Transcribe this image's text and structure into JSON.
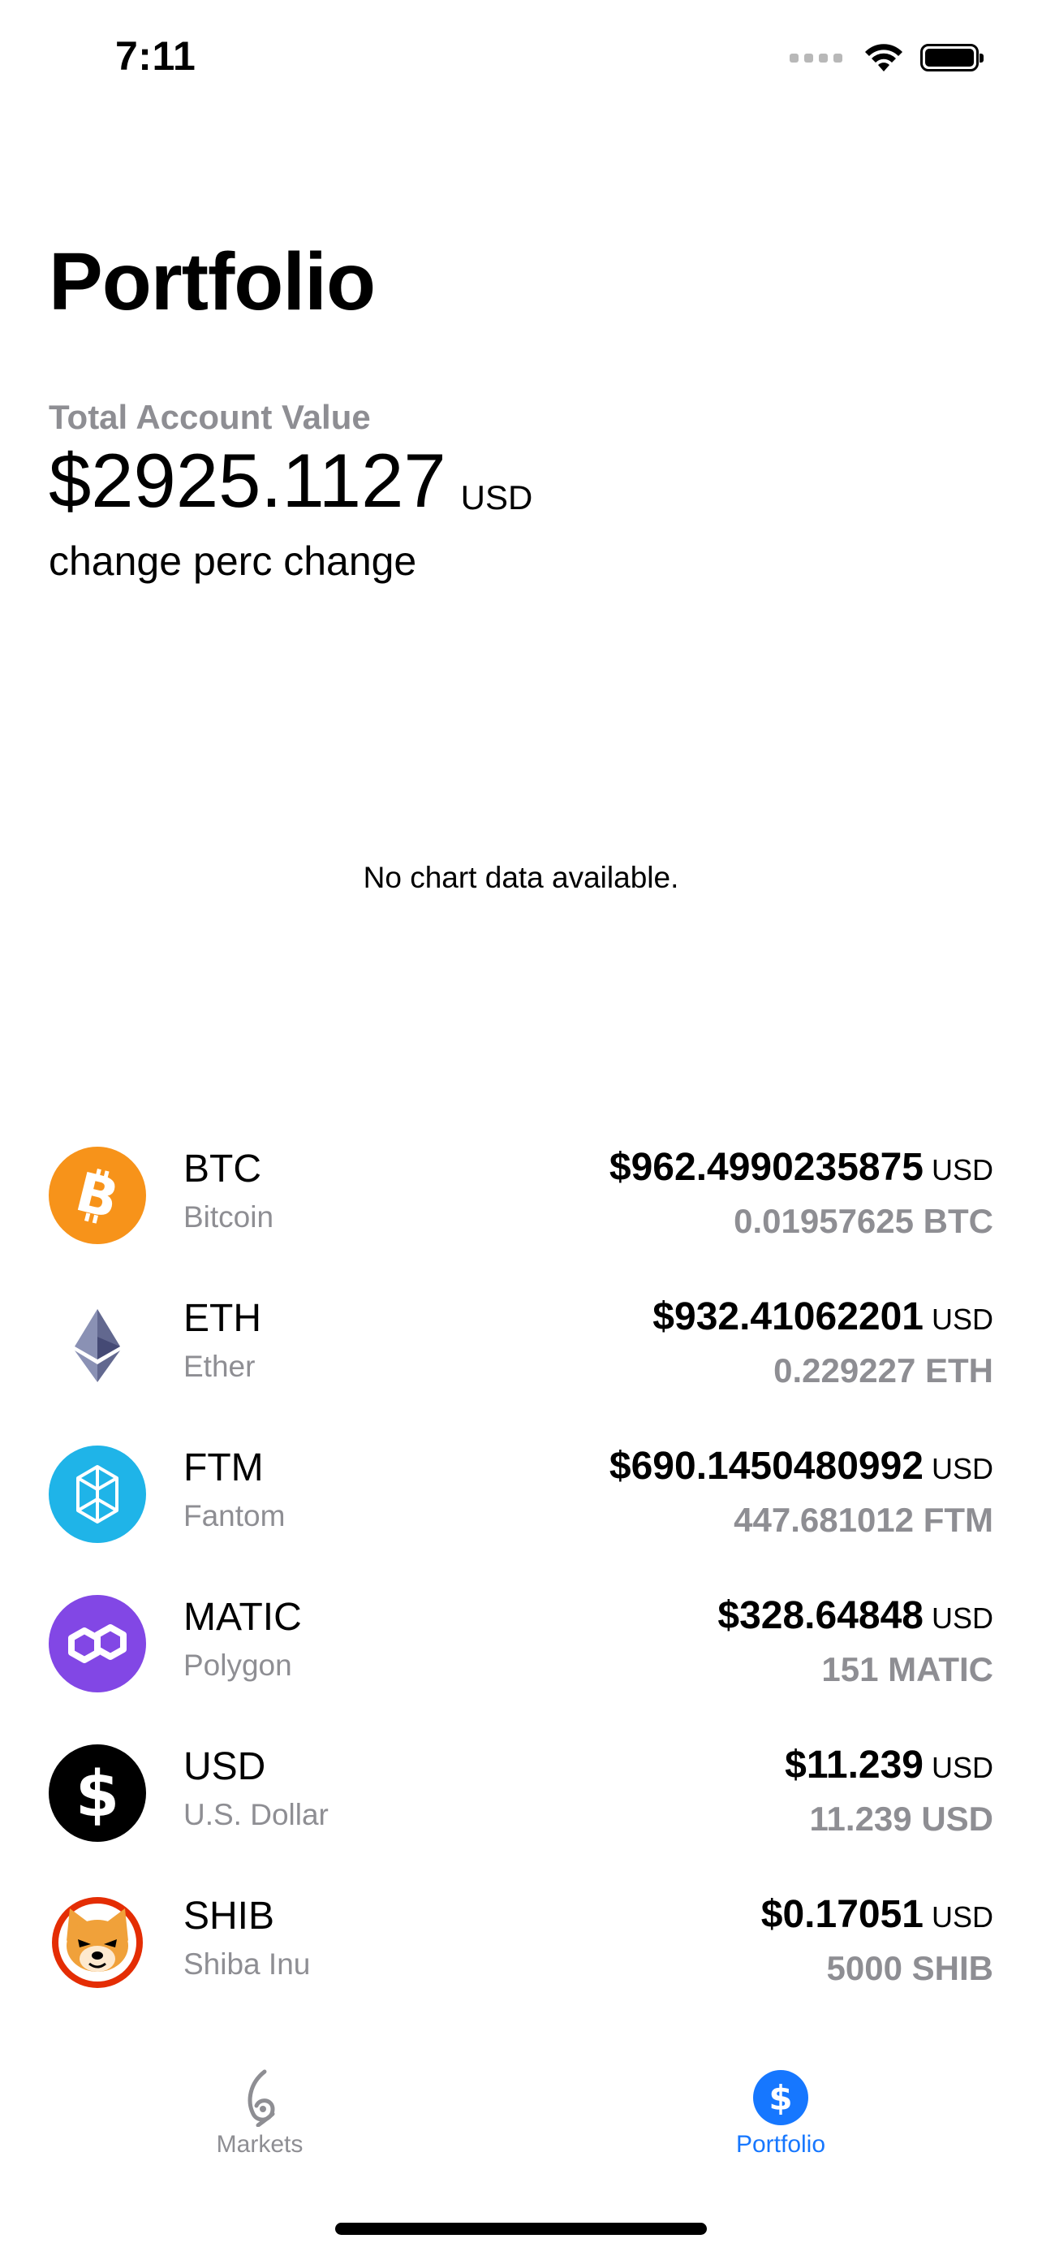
{
  "status_bar": {
    "time": "7:11",
    "icons": [
      "signal-icon",
      "wifi-icon",
      "battery-icon"
    ]
  },
  "page": {
    "title": "Portfolio",
    "total_label": "Total Account Value",
    "total_value": "$2925.1127",
    "total_currency": "USD",
    "change": "change",
    "perc_change": "perc change"
  },
  "chart": {
    "empty_message": "No chart data available."
  },
  "assets": [
    {
      "symbol": "BTC",
      "name": "Bitcoin",
      "value": "$962.4990235875",
      "currency": "USD",
      "quantity": "0.01957625 BTC",
      "icon": "bitcoin-icon",
      "color": "#f7931a"
    },
    {
      "symbol": "ETH",
      "name": "Ether",
      "value": "$932.41062201",
      "currency": "USD",
      "quantity": "0.229227 ETH",
      "icon": "ethereum-icon",
      "color": "#62688f"
    },
    {
      "symbol": "FTM",
      "name": "Fantom",
      "value": "$690.1450480992",
      "currency": "USD",
      "quantity": "447.681012 FTM",
      "icon": "fantom-icon",
      "color": "#1fb4e8"
    },
    {
      "symbol": "MATIC",
      "name": "Polygon",
      "value": "$328.64848",
      "currency": "USD",
      "quantity": "151 MATIC",
      "icon": "polygon-icon",
      "color": "#8247e5"
    },
    {
      "symbol": "USD",
      "name": "U.S. Dollar",
      "value": "$11.239",
      "currency": "USD",
      "quantity": "11.239 USD",
      "icon": "dollar-icon",
      "color": "#000000"
    },
    {
      "symbol": "SHIB",
      "name": "Shiba Inu",
      "value": "$0.17051",
      "currency": "USD",
      "quantity": "5000 SHIB",
      "icon": "shiba-inu-icon",
      "color": "#e42d04"
    }
  ],
  "tabbar": {
    "tabs": [
      {
        "label": "Markets",
        "icon": "markets-icon",
        "active": false
      },
      {
        "label": "Portfolio",
        "icon": "dollar-circle-icon",
        "active": true
      }
    ],
    "active_color": "#1677ff",
    "inactive_color": "#8e8e93"
  }
}
